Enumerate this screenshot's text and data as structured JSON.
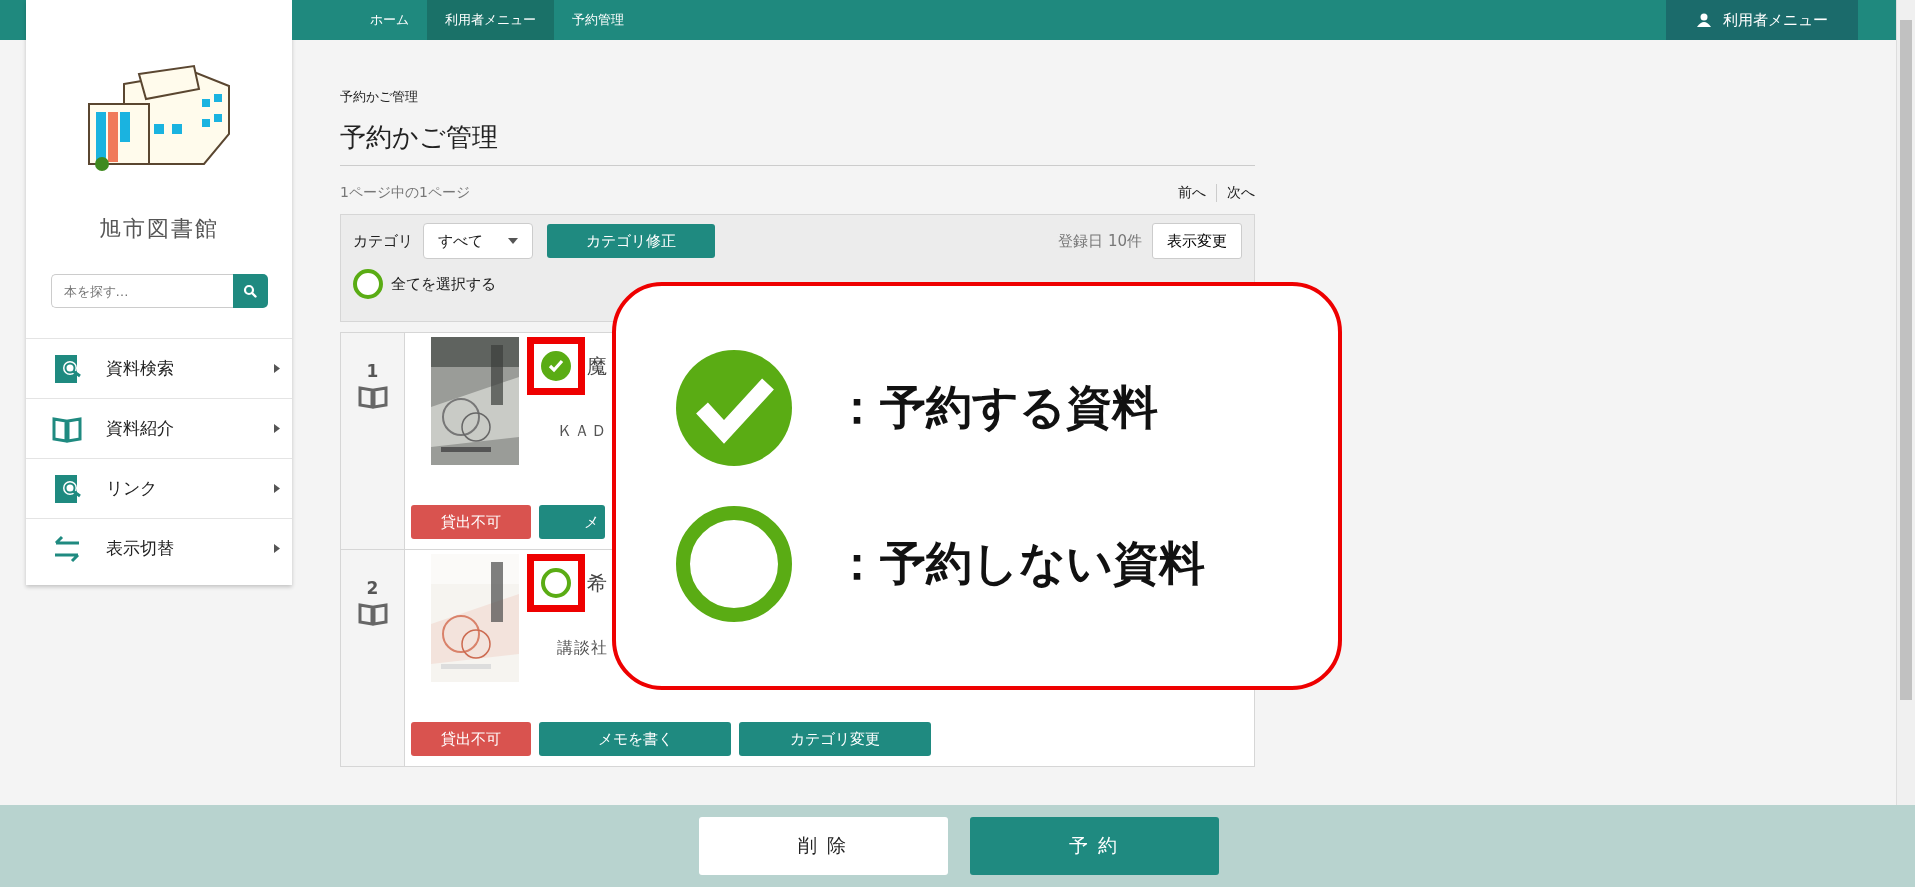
{
  "topbar": {
    "breadcrumbs": [
      {
        "label": "ホーム"
      },
      {
        "label": "利用者メニュー"
      },
      {
        "label": "予約管理"
      }
    ],
    "user_menu": "利用者メニュー"
  },
  "sidebar": {
    "library_name": "旭市図書館",
    "search": {
      "placeholder": "本を探す…"
    },
    "items": [
      {
        "label": "資料検索",
        "kind": "search-book"
      },
      {
        "label": "資料紹介",
        "kind": "open-book"
      },
      {
        "label": "リンク",
        "kind": "search-book"
      },
      {
        "label": "表示切替",
        "kind": "swap"
      }
    ]
  },
  "main": {
    "breadcrumb": "予約かご管理",
    "title": "予約かご管理",
    "page_info": "1ページ中の1ページ",
    "pager": [
      "前へ",
      "次へ"
    ],
    "filter": {
      "label": "カテゴリ",
      "select": "すべて",
      "edit_button": "カテゴリ修正",
      "sort": "登録日 10件",
      "view_button": "表示変更",
      "select_all": {
        "label": "全てを選択する",
        "checked": false
      }
    },
    "items": [
      {
        "number": "1",
        "title": "魔",
        "publisher": "ＫＡＤ",
        "checked": true,
        "highlighted": true,
        "buttons": [
          {
            "label": "貸出不可",
            "kind": "danger"
          },
          {
            "label": "メ",
            "kind": "primary"
          }
        ]
      },
      {
        "number": "2",
        "title": "希",
        "publisher": "講談社",
        "checked": false,
        "highlighted": true,
        "buttons": [
          {
            "label": "貸出不可",
            "kind": "danger"
          },
          {
            "label": "メモを書く",
            "kind": "primary"
          },
          {
            "label": "カテゴリ変更",
            "kind": "primary"
          }
        ]
      }
    ]
  },
  "callout": {
    "entries": [
      {
        "checked": true,
        "text": "：予約する資料"
      },
      {
        "checked": false,
        "text": "：予約しない資料"
      }
    ]
  },
  "footer": {
    "buttons": [
      {
        "label": "削 除",
        "kind": "secondary"
      },
      {
        "label": "予 約",
        "kind": "primary"
      }
    ]
  }
}
